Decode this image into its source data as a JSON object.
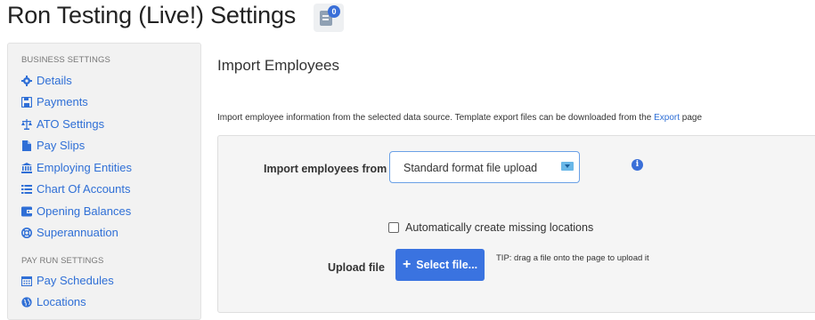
{
  "header": {
    "title": "Ron Testing (Live!) Settings",
    "badge_count": "0"
  },
  "sidebar": {
    "business_heading": "BUSINESS SETTINGS",
    "business_items": [
      {
        "label": "Details",
        "icon": "gear-icon"
      },
      {
        "label": "Payments",
        "icon": "floppy-disk-icon"
      },
      {
        "label": "ATO Settings",
        "icon": "scales-icon"
      },
      {
        "label": "Pay Slips",
        "icon": "file-icon"
      },
      {
        "label": "Employing Entities",
        "icon": "bank-icon"
      },
      {
        "label": "Chart Of Accounts",
        "icon": "list-icon"
      },
      {
        "label": "Opening Balances",
        "icon": "wallet-icon"
      },
      {
        "label": "Superannuation",
        "icon": "life-ring-icon"
      }
    ],
    "payrun_heading": "PAY RUN SETTINGS",
    "payrun_items": [
      {
        "label": "Pay Schedules",
        "icon": "calendar-icon"
      },
      {
        "label": "Locations",
        "icon": "globe-icon"
      }
    ]
  },
  "main": {
    "section_title": "Import Employees",
    "info_text": "Import employee information from the selected data source. Template export files can be downloaded from the",
    "info_link": "Export",
    "info_suffix": "page",
    "import_from_label": "Import employees from",
    "import_from_value": "Standard format file upload",
    "checkbox_label": "Automatically create missing locations",
    "checkbox_checked": false,
    "upload_label": "Upload file",
    "select_file_button": "Select file...",
    "tip": "TIP: drag a file onto the page to upload it"
  },
  "colors": {
    "accent": "#3a73e0",
    "link": "#2f6fd6"
  }
}
